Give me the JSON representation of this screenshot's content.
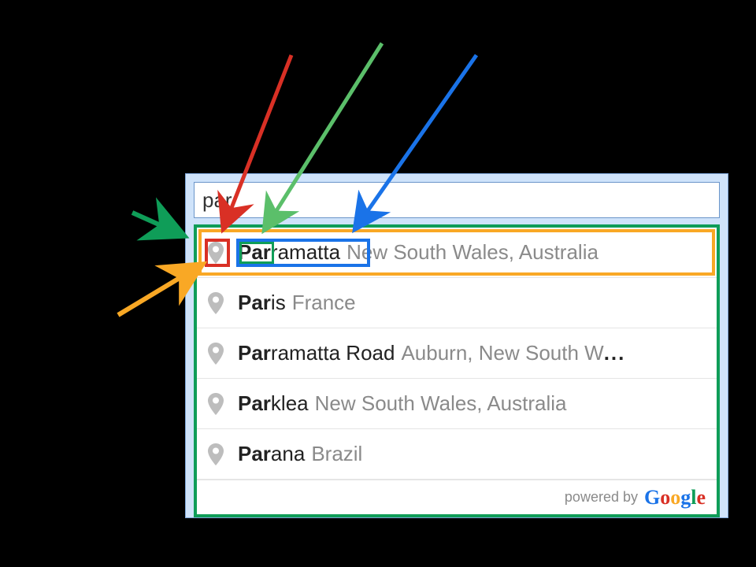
{
  "search": {
    "value": "par"
  },
  "suggestions": [
    {
      "matched": "Par",
      "rest": "ramatta",
      "secondary": "New South Wales, Australia",
      "truncated": false
    },
    {
      "matched": "Par",
      "rest": "is",
      "secondary": "France",
      "truncated": false
    },
    {
      "matched": "Par",
      "rest": "ramatta Road",
      "secondary": "Auburn, New South W",
      "truncated": true
    },
    {
      "matched": "Par",
      "rest": "klea",
      "secondary": "New South Wales, Australia",
      "truncated": false
    },
    {
      "matched": "Par",
      "rest": "ana",
      "secondary": "Brazil",
      "truncated": false
    }
  ],
  "attribution": {
    "prefix": "powered by"
  },
  "ellipsis": "...",
  "annotations": {
    "arrow_colors": {
      "row": "#f9a825",
      "icon": "#d93025",
      "matched": "#0f9d58",
      "primary_light": "#5bbf6a",
      "primary": "#1a73e8",
      "container": "#0f9d58"
    }
  }
}
